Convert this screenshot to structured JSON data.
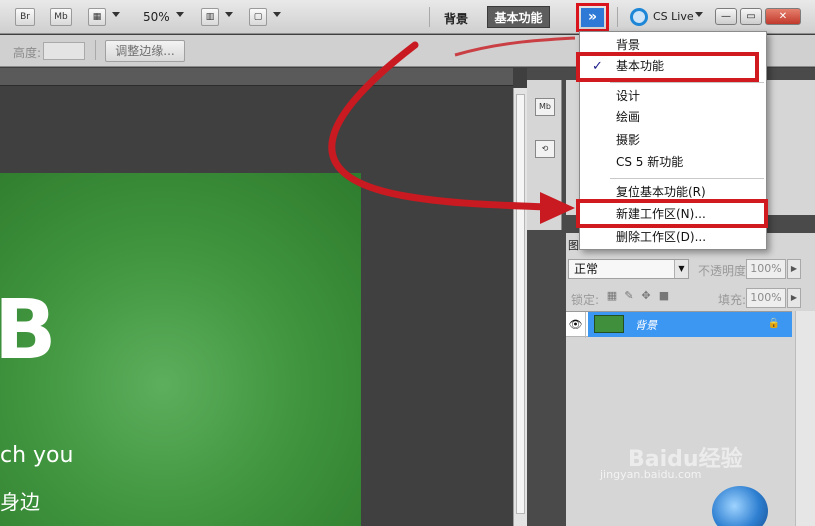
{
  "toolbar": {
    "br_label": "Br",
    "mb_label": "Mb",
    "zoom": "50%",
    "workspace_bg_label": "背景",
    "workspace_active_label": "基本功能",
    "more_label": "»",
    "cs_live_label": "CS Live",
    "window": {
      "minimize": "—",
      "restore": "▭",
      "close": "✕"
    }
  },
  "options_bar": {
    "height_label": "高度:",
    "height_value": "",
    "refine_button": "调整边缘..."
  },
  "canvas": {
    "big_letter": "B",
    "line1": "ch you",
    "line2": "身边"
  },
  "dock": {
    "icons": [
      "Mb",
      "⟲"
    ]
  },
  "layers_panel": {
    "tab_label": "图",
    "blend_mode": "正常",
    "opacity_label": "不透明度:",
    "opacity_value": "100%",
    "lock_label": "锁定:",
    "fill_label": "填充:",
    "fill_value": "100%",
    "layer": {
      "name": "背景",
      "visible": true,
      "locked": true
    }
  },
  "workspace_menu": {
    "items": [
      {
        "label": "背景",
        "checked": false
      },
      {
        "label": "基本功能",
        "checked": true
      },
      {
        "label": "设计",
        "checked": false
      },
      {
        "label": "绘画",
        "checked": false
      },
      {
        "label": "摄影",
        "checked": false
      },
      {
        "label": "CS 5 新功能",
        "checked": false
      },
      {
        "label": "复位基本功能(R)",
        "checked": false
      },
      {
        "label": "新建工作区(N)...",
        "checked": false
      },
      {
        "label": "删除工作区(D)...",
        "checked": false
      }
    ]
  },
  "watermark": {
    "brand": "Baidu经验",
    "url": "jingyan.baidu.com"
  },
  "colors": {
    "annotation_red": "#d11a1f",
    "selection_blue": "#3b97f2",
    "canvas_green": "#41963f"
  }
}
